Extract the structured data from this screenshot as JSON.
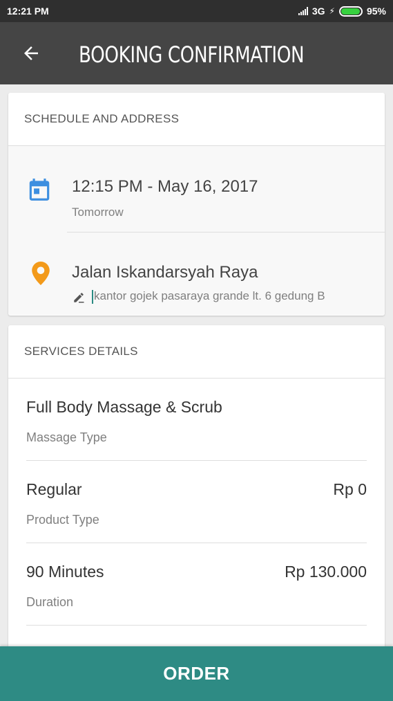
{
  "status_bar": {
    "time": "12:21 PM",
    "network": "3G",
    "battery": "95%",
    "battery_level": 0.95
  },
  "app_bar": {
    "title": "BOOKING CONFIRMATION"
  },
  "schedule": {
    "header": "SCHEDULE AND ADDRESS",
    "datetime": "12:15 PM - May 16, 2017",
    "relative_day": "Tomorrow",
    "address": "Jalan Iskandarsyah Raya",
    "address_note": "kantor gojek pasaraya grande lt. 6 gedung B"
  },
  "services": {
    "header": "SERVICES DETAILS",
    "items": [
      {
        "value": "Full Body Massage & Scrub",
        "label": "Massage Type",
        "price": ""
      },
      {
        "value": "Regular",
        "label": "Product Type",
        "price": "Rp 0"
      },
      {
        "value": "90 Minutes",
        "label": "Duration",
        "price": "Rp 130.000"
      }
    ]
  },
  "order_button": {
    "label": "ORDER"
  },
  "colors": {
    "accent": "#2e8b84",
    "calendar_icon": "#3d8fe0",
    "location_icon": "#f39a1a",
    "app_bar": "#454545"
  }
}
